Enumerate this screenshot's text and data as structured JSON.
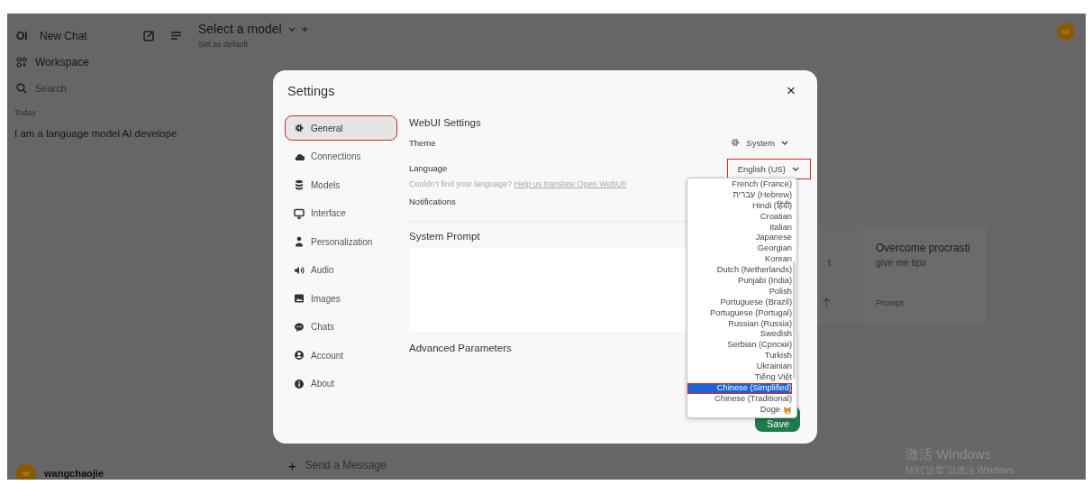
{
  "sidebar": {
    "logo": "OI",
    "new_chat": "New Chat",
    "workspace": "Workspace",
    "search_placeholder": "Search",
    "section": "Today",
    "chats": [
      "I am a language model AI develope"
    ],
    "user": {
      "initial": "W",
      "name": "wangchaojie"
    }
  },
  "header": {
    "model_title": "Select a model",
    "add": "+",
    "set_default": "Set as default",
    "avatar_initial": "W"
  },
  "suggestions": [
    {
      "subtitle": "t",
      "hovered": true
    },
    {
      "title": "Overcome procrasti",
      "subtitle": "give me tips",
      "footer": "Prompt",
      "hovered": false
    }
  ],
  "chat_input": {
    "add": "+",
    "placeholder": "Send a Message"
  },
  "settings": {
    "title": "Settings",
    "close": "×",
    "nav": [
      {
        "label": "General",
        "selected": true,
        "highlighted": true
      },
      {
        "label": "Connections",
        "selected": false,
        "highlighted": false
      },
      {
        "label": "Models",
        "selected": false,
        "highlighted": false
      },
      {
        "label": "Interface",
        "selected": false,
        "highlighted": false
      },
      {
        "label": "Personalization",
        "selected": false,
        "highlighted": false
      },
      {
        "label": "Audio",
        "selected": false,
        "highlighted": false
      },
      {
        "label": "Images",
        "selected": false,
        "highlighted": false
      },
      {
        "label": "Chats",
        "selected": false,
        "highlighted": false
      },
      {
        "label": "Account",
        "selected": false,
        "highlighted": false
      },
      {
        "label": "About",
        "selected": false,
        "highlighted": false
      }
    ],
    "section_title": "WebUI Settings",
    "theme": {
      "label": "Theme",
      "value": "System"
    },
    "language": {
      "label": "Language",
      "value": "English (US)",
      "highlighted": true,
      "hint": "Couldn't find your language?",
      "hint_link": "Help us translate Open WebUI!"
    },
    "notifications": {
      "label": "Notifications"
    },
    "system_prompt": {
      "label": "System Prompt"
    },
    "advanced": "Advanced Parameters",
    "save": "Save"
  },
  "language_menu": [
    {
      "label": "French (France)",
      "selected": false,
      "highlighted": false
    },
    {
      "label": "עברית (Hebrew)",
      "selected": false,
      "highlighted": false
    },
    {
      "label": "Hindi (हिंदी)",
      "selected": false,
      "highlighted": false
    },
    {
      "label": "Croatian",
      "selected": false,
      "highlighted": false
    },
    {
      "label": "Italian",
      "selected": false,
      "highlighted": false
    },
    {
      "label": "Japanese",
      "selected": false,
      "highlighted": false
    },
    {
      "label": "Georgian",
      "selected": false,
      "highlighted": false
    },
    {
      "label": "Korean",
      "selected": false,
      "highlighted": false
    },
    {
      "label": "Dutch (Netherlands)",
      "selected": false,
      "highlighted": false
    },
    {
      "label": "Punjabi (India)",
      "selected": false,
      "highlighted": false
    },
    {
      "label": "Polish",
      "selected": false,
      "highlighted": false
    },
    {
      "label": "Portuguese (Brazil)",
      "selected": false,
      "highlighted": false
    },
    {
      "label": "Portuguese (Portugal)",
      "selected": false,
      "highlighted": false
    },
    {
      "label": "Russian (Russia)",
      "selected": false,
      "highlighted": false
    },
    {
      "label": "Swedish",
      "selected": false,
      "highlighted": false
    },
    {
      "label": "Serbian (Српски)",
      "selected": false,
      "highlighted": false
    },
    {
      "label": "Turkish",
      "selected": false,
      "highlighted": false
    },
    {
      "label": "Ukrainian",
      "selected": false,
      "highlighted": false
    },
    {
      "label": "Tiếng Việt",
      "selected": false,
      "highlighted": false
    },
    {
      "label": "Chinese (Simplified)",
      "selected": true,
      "highlighted": true
    },
    {
      "label": "Chinese (Traditional)",
      "selected": false,
      "highlighted": false
    },
    {
      "label": "Doge",
      "selected": false,
      "highlighted": false,
      "dog": true
    }
  ],
  "os_notice": {
    "title": "激活 Windows",
    "subtitle": "转到“设置”以激活 Windows"
  }
}
